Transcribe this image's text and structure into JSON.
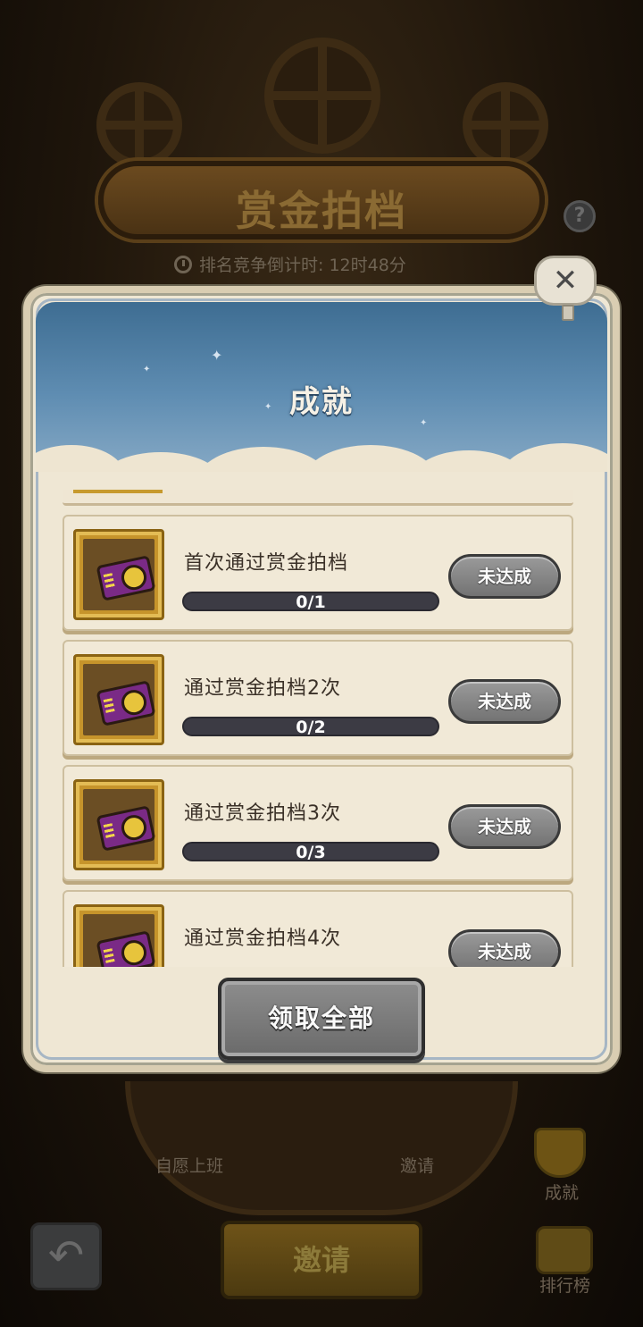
{
  "background": {
    "banner_title": "赏金拍档",
    "help_label": "?",
    "timer_text": "排名竞争倒计时: 12时48分",
    "nav": {
      "volunteer_label": "自愿上班",
      "invite_tab_label": "邀请",
      "achievement_label": "成就",
      "ranking_label": "排行榜"
    },
    "invite_button_label": "邀请",
    "back_icon": "back-arrow-icon"
  },
  "modal": {
    "title": "成就",
    "close_label": "✕",
    "items": [
      {
        "title": "首次通过赏金拍档",
        "progress_text": "0/1",
        "progress": 0,
        "status": "未达成",
        "icon": "ticket-icon"
      },
      {
        "title": "通过赏金拍档2次",
        "progress_text": "0/2",
        "progress": 0,
        "status": "未达成",
        "icon": "ticket-icon"
      },
      {
        "title": "通过赏金拍档3次",
        "progress_text": "0/3",
        "progress": 0,
        "status": "未达成",
        "icon": "ticket-icon"
      },
      {
        "title": "通过赏金拍档4次",
        "progress_text": "",
        "progress": 0,
        "status": "未达成",
        "icon": "ticket-icon"
      }
    ],
    "claim_all_label": "领取全部"
  },
  "colors": {
    "sky": "#4f7ea6",
    "panel": "#efe7d4",
    "disabled_button": "#8a8a8a",
    "progress_track": "#3c3b44"
  }
}
